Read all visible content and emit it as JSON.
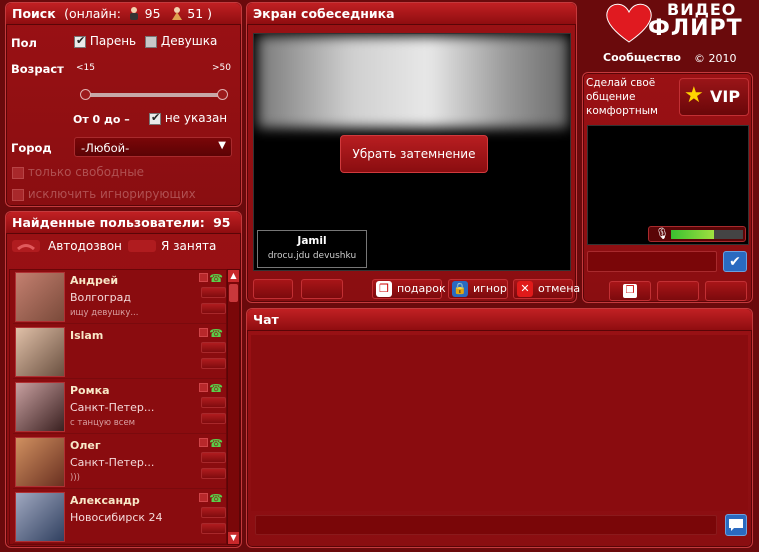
{
  "search": {
    "title": "Поиск",
    "online_label": "(онлайн:",
    "online_male": "95",
    "online_female": "51 )",
    "gender_label": "Пол",
    "gender_male": "Парень",
    "gender_female": "Девушка",
    "age_label": "Возраст",
    "age_min": "<15",
    "age_max": ">50",
    "age_range": "От 0 до –",
    "age_unspecified": "не указан",
    "city_label": "Город",
    "city_value": "-Любой-",
    "only_free": "только свободные",
    "exclude_ignoring": "исключить игнорирующих"
  },
  "found": {
    "title": "Найденные пользователи:",
    "count": "95",
    "autodial": "Автодозвон",
    "busy": "Я занята",
    "users": [
      {
        "name": "Андрей",
        "city": "Волгоград",
        "note": "ищу девушку...",
        "photo": "#7a4a3a"
      },
      {
        "name": "Islam",
        "city": "",
        "note": "",
        "photo": "#6a5040"
      },
      {
        "name": "Ромка",
        "city": "Санкт-Петер...",
        "note": "с танцую всем",
        "photo": "#5a3a36"
      },
      {
        "name": "Олег",
        "city": "Санкт-Петер...",
        "note": ")))",
        "photo": "#8a5030"
      },
      {
        "name": "Александр",
        "city": "Новосибирск 24",
        "note": "",
        "photo": "#4a4a6a"
      }
    ]
  },
  "partner_screen": {
    "title": "Экран собеседника",
    "remove_blur": "Убрать затемнение",
    "partner_name": "Jamil",
    "partner_status": "drocu.jdu devushku",
    "gift": "подарок",
    "ignore": "игнор",
    "cancel": "отмена"
  },
  "brand": {
    "logo_top": "ВИДЕО",
    "logo_bottom": "ФЛИРТ",
    "community": "Сообщество",
    "copyright": "© 2010"
  },
  "vip": {
    "promo": "Сделай своё общение комфортным",
    "badge": "VIP"
  },
  "chat": {
    "title": "Чат",
    "input_value": ""
  },
  "colors": {
    "bg": "#6a0a0c",
    "panel": "#9a1114",
    "accent": "#c12023"
  }
}
